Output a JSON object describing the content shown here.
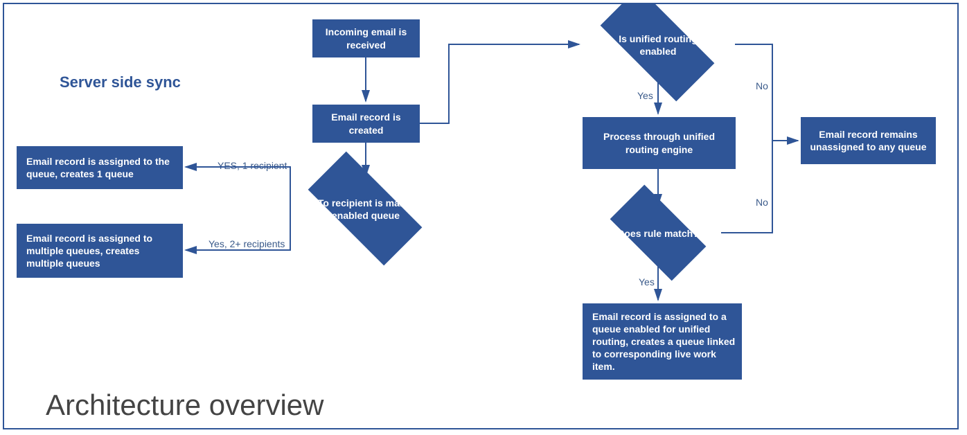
{
  "titles": {
    "section": "Server side sync",
    "main": "Architecture overview"
  },
  "nodes": {
    "incoming": "Incoming email is received",
    "created": "Email record is created",
    "toRecipient": "If To recipient is mailbox enabled queue",
    "assigned1": "Email record is assigned to the queue, creates 1 queue",
    "assignedMulti": "Email record is assigned to multiple queues, creates multiple queues",
    "unifiedRouting": "Is unified routing enabled",
    "processEngine": "Process through unified routing engine",
    "ruleMatch": "Does rule match?",
    "assignedUnified": "Email record is assigned to a queue enabled for unified routing, creates a queue linked to corresponding live work item.",
    "remainsUnassigned": "Email record remains unassigned to any queue"
  },
  "edges": {
    "yes1": "YES, 1 recipient",
    "yesMulti": "Yes, 2+ recipients",
    "yes": "Yes",
    "no": "No"
  },
  "chart_data": {
    "type": "flowchart",
    "title": "Architecture overview",
    "section_label": "Server side sync",
    "nodes": [
      {
        "id": "incoming",
        "type": "process",
        "label": "Incoming email is received"
      },
      {
        "id": "created",
        "type": "process",
        "label": "Email record is created"
      },
      {
        "id": "toRecipient",
        "type": "decision",
        "label": "If To recipient is mailbox enabled queue"
      },
      {
        "id": "assigned1",
        "type": "process",
        "label": "Email record is assigned to the queue, creates 1 queue"
      },
      {
        "id": "assignedMulti",
        "type": "process",
        "label": "Email record is assigned to multiple queues, creates multiple queues"
      },
      {
        "id": "unifiedRouting",
        "type": "decision",
        "label": "Is unified routing enabled"
      },
      {
        "id": "processEngine",
        "type": "process",
        "label": "Process through unified routing engine"
      },
      {
        "id": "ruleMatch",
        "type": "decision",
        "label": "Does rule match?"
      },
      {
        "id": "assignedUnified",
        "type": "process",
        "label": "Email record is assigned to a queue enabled for unified routing, creates a queue linked to corresponding live work item."
      },
      {
        "id": "remainsUnassigned",
        "type": "process",
        "label": "Email record remains unassigned to any queue"
      }
    ],
    "edges": [
      {
        "from": "incoming",
        "to": "created",
        "label": ""
      },
      {
        "from": "created",
        "to": "toRecipient",
        "label": ""
      },
      {
        "from": "created",
        "to": "unifiedRouting",
        "label": ""
      },
      {
        "from": "toRecipient",
        "to": "assigned1",
        "label": "YES, 1 recipient"
      },
      {
        "from": "toRecipient",
        "to": "assignedMulti",
        "label": "Yes, 2+ recipients"
      },
      {
        "from": "unifiedRouting",
        "to": "processEngine",
        "label": "Yes"
      },
      {
        "from": "unifiedRouting",
        "to": "remainsUnassigned",
        "label": "No"
      },
      {
        "from": "processEngine",
        "to": "ruleMatch",
        "label": ""
      },
      {
        "from": "ruleMatch",
        "to": "assignedUnified",
        "label": "Yes"
      },
      {
        "from": "ruleMatch",
        "to": "remainsUnassigned",
        "label": "No"
      }
    ]
  }
}
